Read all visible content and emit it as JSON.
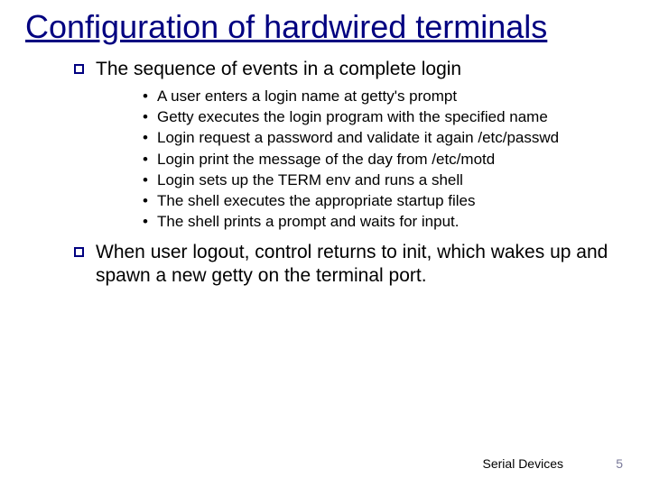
{
  "title": "Configuration of hardwired terminals",
  "points": {
    "p1": "The sequence of events in a complete login",
    "p1_sub": [
      "A user enters a login name at getty's prompt",
      "Getty executes the login program with the specified name",
      "Login request a password and validate it again /etc/passwd",
      "Login print the message of the day from /etc/motd",
      "Login sets up the TERM env and runs a shell",
      "The shell executes the appropriate startup files",
      "The shell prints a prompt and waits for input."
    ],
    "p2": "When user logout, control returns to init, which wakes up and spawn a new getty on the terminal port."
  },
  "footer": {
    "label": "Serial Devices",
    "page": "5"
  },
  "bullets": {
    "dot": "•"
  }
}
